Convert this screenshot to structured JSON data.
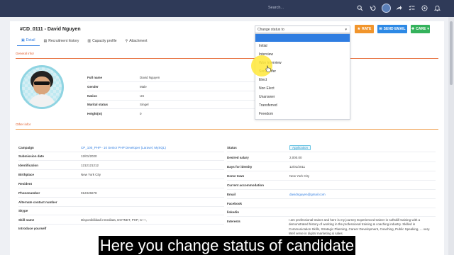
{
  "topbar": {
    "search_placeholder": "Search...",
    "icons": [
      "search-icon",
      "history-icon",
      "refresh-icon",
      "share-icon",
      "tasks-icon",
      "help-icon",
      "bell-icon"
    ]
  },
  "candidate": {
    "title": "#CD_0111 - David Nguyen",
    "tabs": [
      "Detail",
      "Recruitment history",
      "Capacity profile",
      "Attachment"
    ]
  },
  "actions": {
    "status_placeholder": "Change status to",
    "rate_label": "RATE",
    "email_label": "SEND EMAIL",
    "care_label": "CARE"
  },
  "status_options": [
    "Initial",
    "Interview",
    "Won Interview",
    "Send Offer",
    "Elect",
    "Non Elect",
    "Unanswer",
    "Transferred",
    "Freedom"
  ],
  "general": {
    "section_title": "General infor",
    "fields": [
      {
        "label": "Full name",
        "value": "David Nguyen"
      },
      {
        "label": "Gender",
        "value": "Male"
      },
      {
        "label": "Nation",
        "value": "US"
      },
      {
        "label": "Marital status",
        "value": "Singel"
      },
      {
        "label": "Height(m)",
        "value": "0"
      }
    ]
  },
  "other": {
    "section_title": "Other infor",
    "left": [
      {
        "label": "Campaign",
        "value": "CP_100_PHP - 10 Senior PHP Developer (Laravel, MySQL)"
      },
      {
        "label": "Submission date",
        "value": "12/01/2020"
      },
      {
        "label": "Identification",
        "value": "1212121212"
      },
      {
        "label": "Birthplace",
        "value": "New York City"
      },
      {
        "label": "Resident",
        "value": ""
      },
      {
        "label": "Phonenumber",
        "value": "012345678"
      },
      {
        "label": "Alternate contact number",
        "value": ""
      },
      {
        "label": "Skype",
        "value": ""
      },
      {
        "label": "Skill name",
        "value": "Disponibilidad inmediata, DOTNET, PHP, C++,"
      },
      {
        "label": "Introduce yourself",
        "value": ""
      }
    ],
    "right": [
      {
        "label": "Status",
        "value": "Application"
      },
      {
        "label": "Desired salary",
        "value": "2,000.00"
      },
      {
        "label": "Days for identity",
        "value": "12/01/2011"
      },
      {
        "label": "Home town",
        "value": "New York City"
      },
      {
        "label": "Current accommodation",
        "value": ""
      },
      {
        "label": "Email",
        "value": "davidnguyen@gmail.com"
      },
      {
        "label": "Facebook",
        "value": ""
      },
      {
        "label": "linkedin",
        "value": ""
      },
      {
        "label": "Interests",
        "value": "I am professional trainer and here is my journey Experienced trainer in softskill training with a demonstrated history of working in the professional training & coaching industry. Skilled in Communication Skills, Strategic Planning, Career Development, Coaching, Public Speaking, ... very. Well verse in digital marketing & sales"
      }
    ]
  },
  "caption": "Here you change status of candidate",
  "colors": {
    "topbar": "#2f3a58",
    "accent": "#2f7de1",
    "rate": "#f1952c",
    "email": "#2d89e5",
    "care": "#34b25c"
  }
}
